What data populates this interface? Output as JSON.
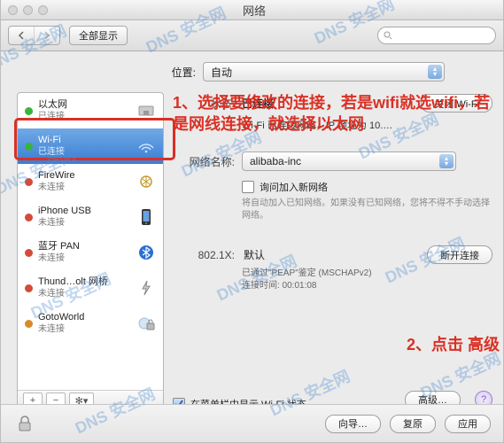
{
  "window": {
    "title": "网络"
  },
  "toolbar": {
    "show_all": "全部显示"
  },
  "location": {
    "label": "位置:",
    "value": "自动"
  },
  "sidebar": {
    "items": [
      {
        "name": "以太网",
        "status": "已连接",
        "dot": "green"
      },
      {
        "name": "Wi-Fi",
        "status": "已连接",
        "dot": "green"
      },
      {
        "name": "FireWire",
        "status": "未连接",
        "dot": "red"
      },
      {
        "name": "iPhone USB",
        "status": "未连接",
        "dot": "red"
      },
      {
        "name": "蓝牙 PAN",
        "status": "未连接",
        "dot": "red"
      },
      {
        "name": "Thund…olt 网桥",
        "status": "未连接",
        "dot": "red"
      },
      {
        "name": "GotoWorld",
        "status": "未连接",
        "dot": "orange"
      }
    ]
  },
  "detail": {
    "status_label": "状态:",
    "status_value": "已连接",
    "status_btn": "关闭 Wi-Fi",
    "status_desc": "Wi-Fi 已连接网络，IP 地址为 10.…",
    "network_label": "网络名称:",
    "network_value": "alibaba-inc",
    "ask_join": "询问加入新网络",
    "ask_join_hint": "将自动加入已知网络。如果没有已知网络，您将不得不手动选择网络。",
    "eightx_label": "802.1X:",
    "eightx_value": "默认",
    "disconnect": "断开连接",
    "eightx_info1": "已通过\"PEAP\"鉴定 (MSCHAPv2)",
    "eightx_info2": "连接时间:  00:01:08",
    "menubar_chk": "在菜单栏中显示 Wi-Fi 状态",
    "advanced": "高级…"
  },
  "footer": {
    "guide": "向导…",
    "revert": "复原",
    "apply": "应用"
  },
  "annotations": {
    "a1": "1、选择要修改的连接，若是wifi就选wifi，若是网线连接，就选择以太网",
    "a2": "2、点击 高级"
  },
  "watermark": "DNS 安全网"
}
